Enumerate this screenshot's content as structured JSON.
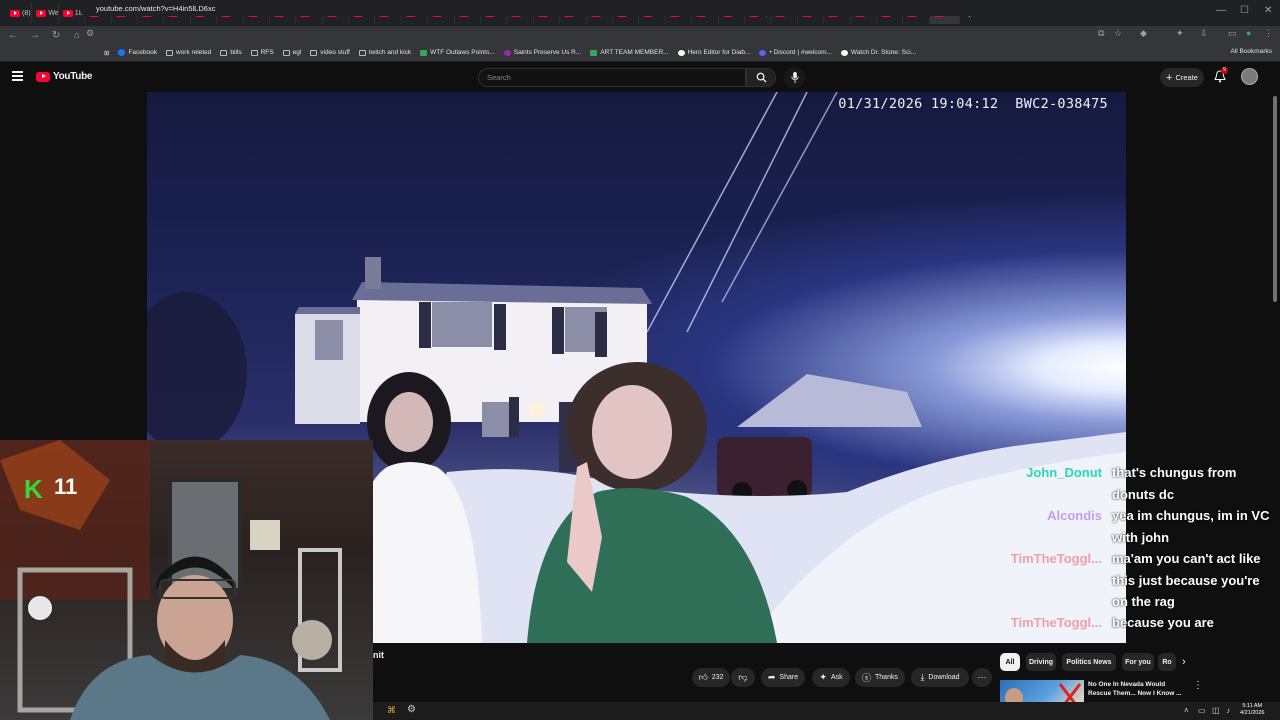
{
  "browser": {
    "tabs": [
      "(8)",
      "We",
      "18-",
      "Ho",
      "Ro",
      "The",
      "Ch",
      "Ah",
      "Ma",
      "Ma",
      "Sh",
      "Dis",
      "A J",
      "Dn",
      "Me",
      "Sili",
      "*SI",
      "Pol",
      "EXI",
      "We",
      "Pol",
      "Les",
      "Evi",
      "Ce",
      "Gir",
      "We",
      "Kn",
      "We",
      "Spi",
      "Am",
      "Sh",
      "Ma",
      "DU",
      "Me",
      "Dn",
      ""
    ],
    "active_tab_index": 35,
    "url": "youtube.com/watch?v=H4in5lLD6xc",
    "bookmarks": [
      {
        "label": "Facebook",
        "icon": "facebook-icon",
        "kind": "f"
      },
      {
        "label": "work releted",
        "icon": "folder-icon",
        "kind": ""
      },
      {
        "label": "bills",
        "icon": "folder-icon",
        "kind": ""
      },
      {
        "label": "RFS",
        "icon": "folder-icon",
        "kind": ""
      },
      {
        "label": "egl",
        "icon": "folder-icon",
        "kind": ""
      },
      {
        "label": "video stuff",
        "icon": "folder-icon",
        "kind": ""
      },
      {
        "label": "twitch and kick",
        "icon": "folder-icon",
        "kind": ""
      },
      {
        "label": "WTF Outlaws Points...",
        "icon": "sheet-icon",
        "kind": "g"
      },
      {
        "label": "Saints Preserve Us R...",
        "icon": "page-icon",
        "kind": "p"
      },
      {
        "label": "ART TEAM MEMBER...",
        "icon": "sheet-icon",
        "kind": "g"
      },
      {
        "label": "Hero Editor for Diab...",
        "icon": "page-icon",
        "kind": "h"
      },
      {
        "label": "• Discord | #welcom...",
        "icon": "discord-icon",
        "kind": "d"
      },
      {
        "label": "Watch Dr. Stone: Sci...",
        "icon": "page-icon",
        "kind": "h"
      }
    ],
    "all_bookmarks_label": "All Bookmarks"
  },
  "youtube": {
    "logo_text": "YouTube",
    "search_placeholder": "Search",
    "create_label": "Create",
    "notification_count": "9"
  },
  "video": {
    "timestamp": "01/31/2026 19:04:12",
    "camera_id": "BWC2-038475"
  },
  "overlay": {
    "k_logo": "K",
    "k_count": "11",
    "partial_title": "nit"
  },
  "chat": [
    {
      "user": "John_Donut",
      "color": "#2bd6b5",
      "message": "that's chungus from donuts dc"
    },
    {
      "user": "Alcondis",
      "color": "#c79cf0",
      "message": "yea im chungus, im in VC with john"
    },
    {
      "user": "TimTheToggl...",
      "color": "#f0a0a0",
      "message": "ma'am you can't act like this just because you're on the rag"
    },
    {
      "user": "TimTheToggl...",
      "color": "#f0a0a0",
      "message": "because you are"
    }
  ],
  "actions": {
    "like_count": "232",
    "share_label": "Share",
    "ask_label": "Ask",
    "thanks_label": "Thanks",
    "download_label": "Download"
  },
  "chips": [
    "All",
    "Driving",
    "Politics News",
    "For you",
    "Ro"
  ],
  "recommendation": {
    "title": "No One In Nevada Would Rescue Them... Now I Know ..."
  },
  "taskbar": {
    "time": "5:11 AM",
    "date": "4/21/2026"
  }
}
